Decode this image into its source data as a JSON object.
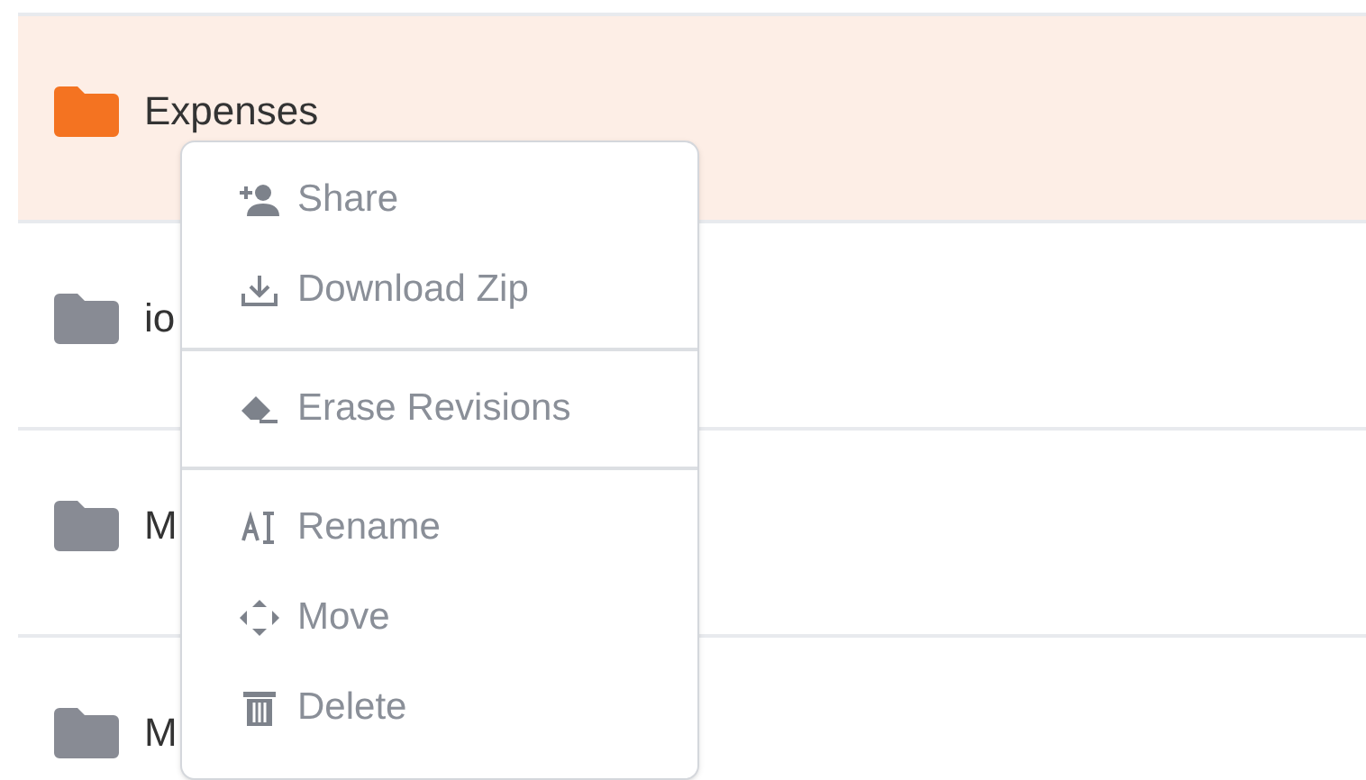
{
  "folders": [
    {
      "name": "Expenses",
      "selected": true
    },
    {
      "name": "io",
      "selected": false
    },
    {
      "name": "M",
      "selected": false
    },
    {
      "name": "M",
      "selected": false
    }
  ],
  "context_menu": {
    "groups": [
      [
        "Share",
        "Download Zip"
      ],
      [
        "Erase Revisions"
      ],
      [
        "Rename",
        "Move",
        "Delete"
      ]
    ]
  }
}
